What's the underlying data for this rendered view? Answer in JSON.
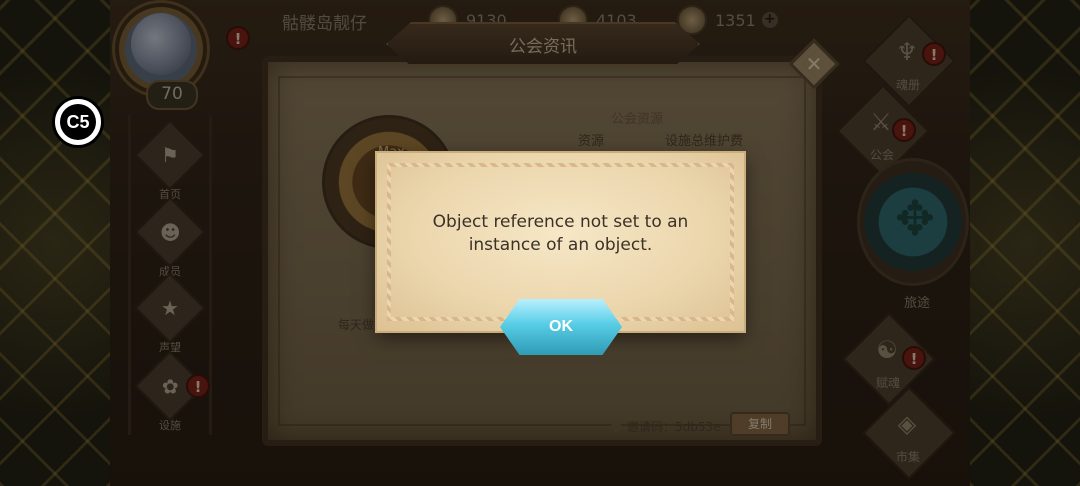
{
  "player": {
    "name": "骷髅岛靓仔",
    "level": "70",
    "alert": "!"
  },
  "resources": [
    {
      "icon": "coin-icon",
      "value": "9130"
    },
    {
      "icon": "gem-icon",
      "value": "4103"
    },
    {
      "icon": "crystal-icon",
      "value": "1351",
      "plus": "+"
    }
  ],
  "left_nav": [
    {
      "label": "首页",
      "icon": "home-icon"
    },
    {
      "label": "成员",
      "icon": "members-icon"
    },
    {
      "label": "声望",
      "icon": "reputation-icon"
    },
    {
      "label": "设施",
      "icon": "facility-icon",
      "alert": "!"
    }
  ],
  "right_nav": [
    {
      "label": "魂册",
      "icon": "soul-book-icon",
      "alert": "!"
    },
    {
      "label": "公会",
      "icon": "guild-icon",
      "alert": "!"
    },
    {
      "label": "旅途",
      "icon": "journey-icon"
    },
    {
      "label": "赋魂",
      "icon": "enchant-icon",
      "alert": "!"
    },
    {
      "label": "市集",
      "icon": "market-icon"
    }
  ],
  "panel": {
    "title": "公会资讯",
    "section_label": "公会资源",
    "col_resource": "资源",
    "col_upkeep": "设施总维护费",
    "emblem_text": "Max",
    "daily_text": "每天做",
    "invite_text": "邀请码：5db53e",
    "copy_label": "复制"
  },
  "dialog": {
    "message_line1": "Object reference not set to an",
    "message_line2": "instance of an object.",
    "ok_label": "OK"
  },
  "overlay_logo": "C5",
  "colors": {
    "dialog_bg": "#f0ddb8",
    "ok_button": "#58cde6",
    "alert": "#7a1f16"
  }
}
